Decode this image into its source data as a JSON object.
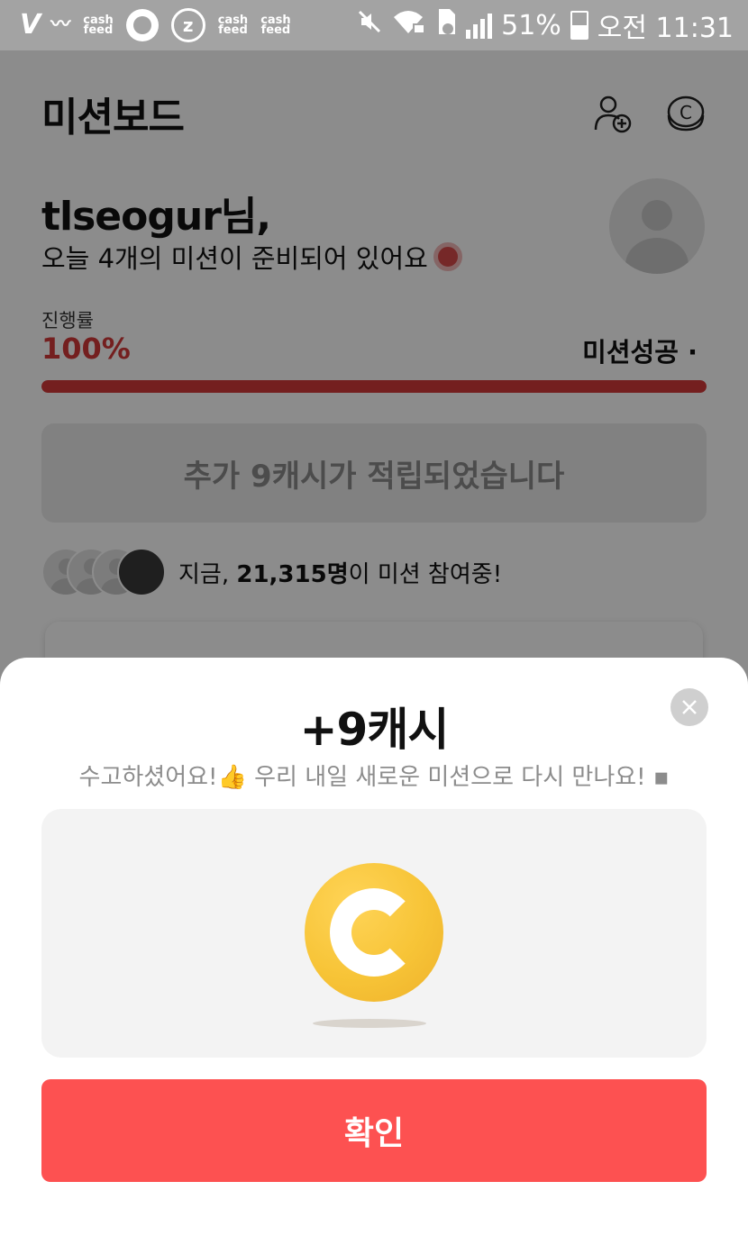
{
  "status_bar": {
    "icons": [
      "v-logo-icon",
      "wavy-icon",
      "cashfeed-icon",
      "gear-badge-icon",
      "z-icon",
      "cashfeed-icon",
      "cashfeed-icon",
      "mute-icon",
      "wifi-lock-icon",
      "sd-card-icon",
      "signal-icon"
    ],
    "battery": "51%",
    "time": "오전 11:31",
    "cashfeed_text": "cash\nfeed"
  },
  "header": {
    "title": "미션보드",
    "add_friend_icon": "person-plus-icon",
    "coin_icon": "coin-c-icon"
  },
  "greeting": {
    "name": "tlseogur님,",
    "message": "오늘 4개의 미션이 준비되어 있어요"
  },
  "progress": {
    "label": "진행률",
    "value_text": "100%",
    "fraction": 1.0,
    "status": "미션성공 ·"
  },
  "banner": {
    "text": "추가 9캐시가 적립되었습니다"
  },
  "participants": {
    "prefix": "지금, ",
    "count": "21,315명",
    "suffix": "이 미션 참여중!"
  },
  "sheet": {
    "title": "+9캐시",
    "message": "수고하셨어요!👍 우리 내일 새로운 미션으로 다시 만나요! ▪",
    "confirm_label": "확인"
  },
  "colors": {
    "accent_red": "#fd5151",
    "progress_red": "#d43a3a",
    "coin_gold": "#f7c437"
  }
}
